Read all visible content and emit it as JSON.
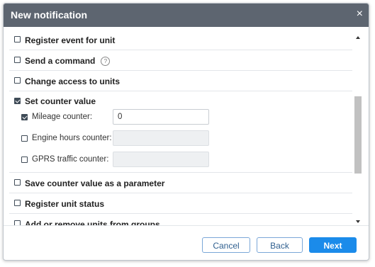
{
  "dialog": {
    "title": "New notification",
    "close_glyph": "×"
  },
  "actions": [
    {
      "label": "Register event for unit",
      "checked": false
    },
    {
      "label": "Send a command",
      "checked": false,
      "help": "?"
    },
    {
      "label": "Change access to units",
      "checked": false
    }
  ],
  "counter_group": {
    "label": "Set counter value",
    "checked": true,
    "items": [
      {
        "label": "Mileage counter:",
        "checked": true,
        "value": "0",
        "enabled": true
      },
      {
        "label": "Engine hours counter:",
        "checked": false,
        "value": "",
        "enabled": false
      },
      {
        "label": "GPRS traffic counter:",
        "checked": false,
        "value": "",
        "enabled": false
      }
    ]
  },
  "actions_after": [
    {
      "label": "Save counter value as a parameter",
      "checked": false
    },
    {
      "label": "Register unit status",
      "checked": false
    },
    {
      "label": "Add or remove units from groups",
      "checked": false
    }
  ],
  "footer": {
    "cancel_label": "Cancel",
    "back_label": "Back",
    "next_label": "Next"
  },
  "colors": {
    "header": "#5d6570",
    "primary": "#1b8bea",
    "checkbox": "#3f4b57"
  }
}
